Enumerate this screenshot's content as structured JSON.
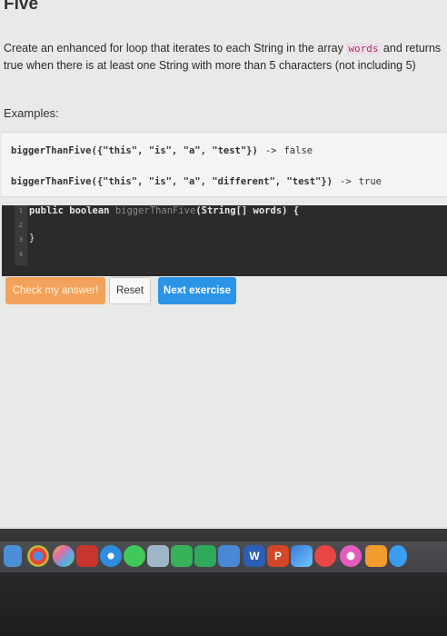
{
  "page": {
    "title": "Five",
    "description_before": "Create an enhanced for loop that iterates to each String in the array ",
    "description_keyword": "words",
    "description_after": " and returns true when there is at least one String with more than 5 characters (not including 5)",
    "examples_label": "Examples:"
  },
  "examples": [
    {
      "call": "biggerThanFive({\"this\", \"is\", \"a\", \"test\"})",
      "arrow": "->",
      "result": "false"
    },
    {
      "call": "biggerThanFive({\"this\", \"is\", \"a\", \"different\", \"test\"})",
      "arrow": "->",
      "result": "true"
    }
  ],
  "editor": {
    "line_numbers": [
      "1",
      "2",
      "3",
      "4"
    ],
    "line1_keywords": "public boolean ",
    "line1_fn": "biggerThanFive",
    "line1_params": "(String[] words) {",
    "line3": "}"
  },
  "buttons": {
    "check": "Check my answer!",
    "reset": "Reset",
    "next": "Next exercise"
  },
  "dock": {
    "icons": [
      "finder-icon",
      "chrome-icon",
      "photos-icon",
      "photo-booth-icon",
      "safari-icon",
      "messages-icon",
      "preview-icon",
      "facetime-icon",
      "numbers-icon",
      "keynote-icon",
      "word-icon",
      "powerpoint-icon",
      "photos-app-icon",
      "news-icon",
      "itunes-icon",
      "ibooks-icon",
      "app-store-icon"
    ],
    "word_letter": "W",
    "powerpoint_letter": "P"
  },
  "colors": {
    "check_button": "#f3a25b",
    "next_button": "#2b94e6",
    "editor_bg": "#2b2b2b",
    "keyword_bg": "#eadfe8"
  }
}
